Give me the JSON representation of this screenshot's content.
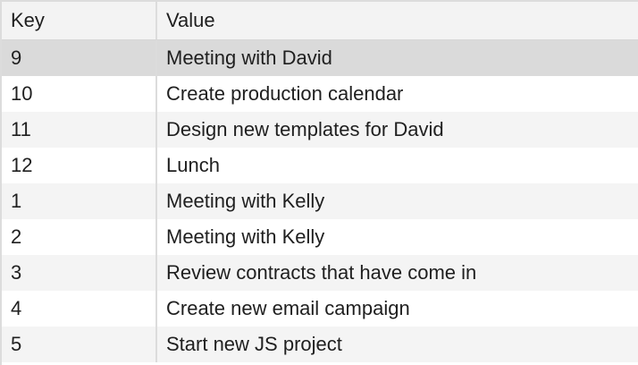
{
  "table": {
    "columns": {
      "key": "Key",
      "value": "Value"
    },
    "selected_index": 0,
    "rows": [
      {
        "key": "9",
        "value": "Meeting with David"
      },
      {
        "key": "10",
        "value": "Create production calendar"
      },
      {
        "key": "11",
        "value": "Design new templates for David"
      },
      {
        "key": "12",
        "value": "Lunch"
      },
      {
        "key": "1",
        "value": "Meeting with Kelly"
      },
      {
        "key": "2",
        "value": "Meeting with Kelly"
      },
      {
        "key": "3",
        "value": "Review contracts that have come in"
      },
      {
        "key": "4",
        "value": "Create new email campaign"
      },
      {
        "key": "5",
        "value": "Start new JS project"
      }
    ]
  }
}
